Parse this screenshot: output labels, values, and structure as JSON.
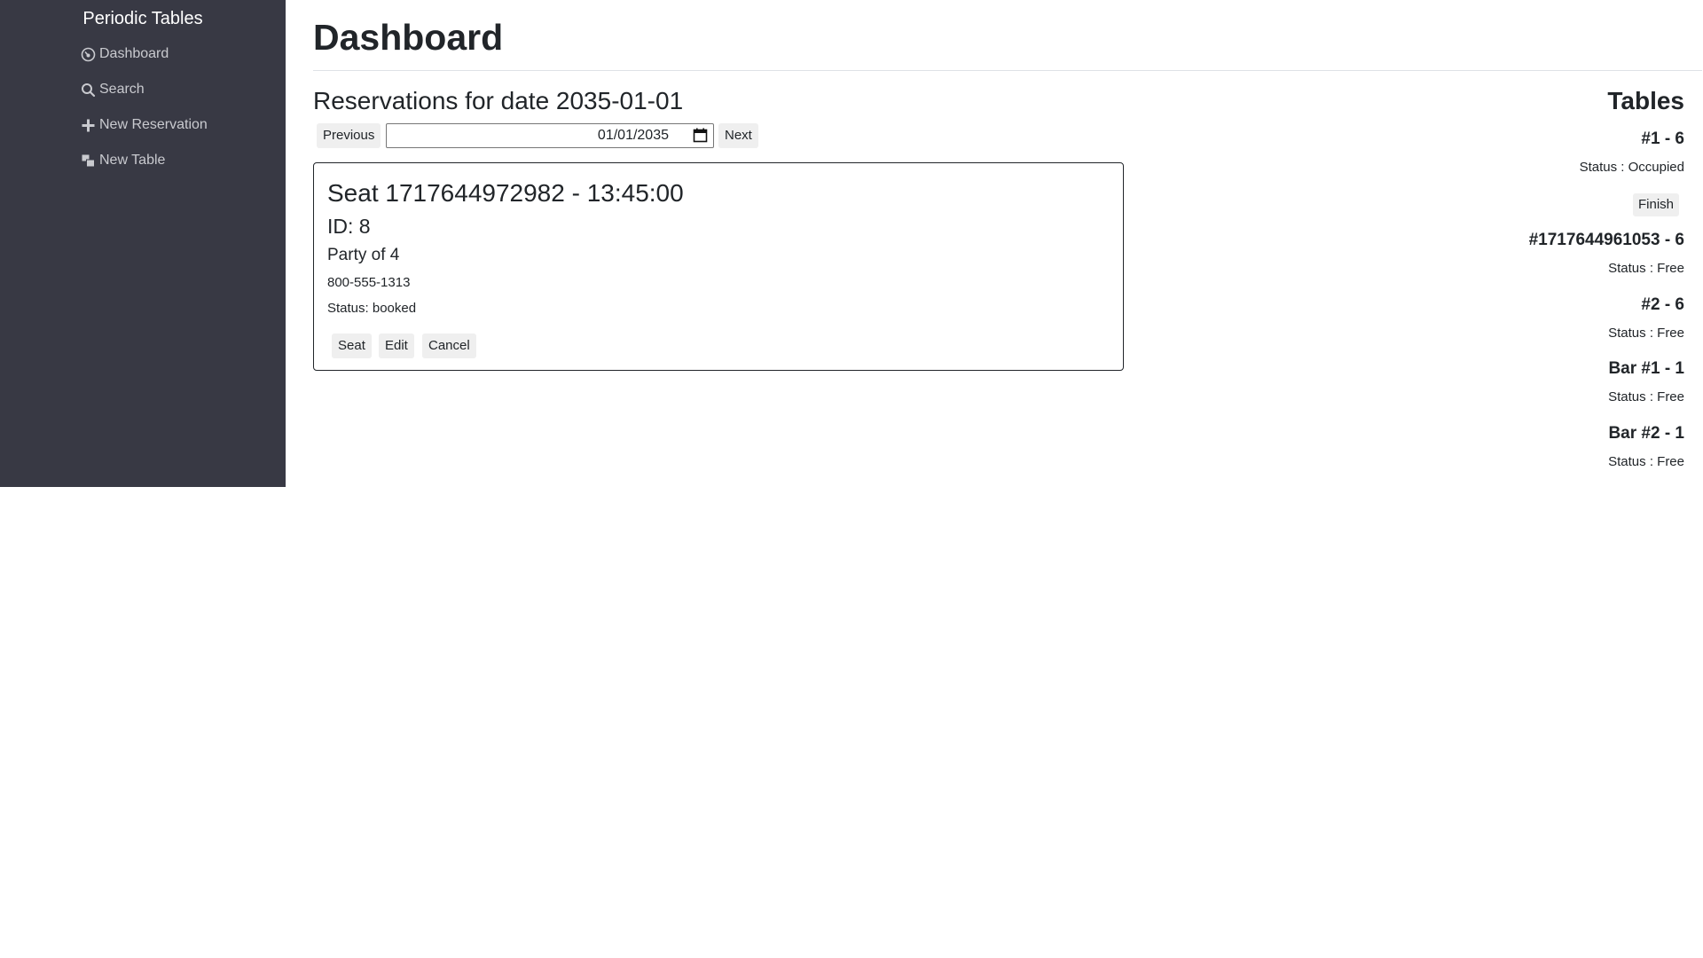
{
  "sidebar": {
    "brand": "Periodic Tables",
    "items": [
      {
        "label": "Dashboard",
        "icon": "dashboard-icon"
      },
      {
        "label": "Search",
        "icon": "search-icon"
      },
      {
        "label": "New Reservation",
        "icon": "plus-icon"
      },
      {
        "label": "New Table",
        "icon": "layers-icon"
      }
    ]
  },
  "main": {
    "title": "Dashboard",
    "reservations_heading": "Reservations for date 2035-01-01",
    "date_nav": {
      "previous_label": "Previous",
      "date_value": "01/01/2035",
      "next_label": "Next"
    },
    "reservations": [
      {
        "title": "Seat 1717644972982 - 13:45:00",
        "id_text": "ID: 8",
        "party_text": "Party of 4",
        "phone": "800-555-1313",
        "status_text": "Status: booked",
        "actions": {
          "seat": "Seat",
          "edit": "Edit",
          "cancel": "Cancel"
        }
      }
    ]
  },
  "tables": {
    "heading": "Tables",
    "items": [
      {
        "name": "#1 - 6",
        "status": "Status : Occupied",
        "finish_label": "Finish"
      },
      {
        "name": "#1717644961053 - 6",
        "status": "Status : Free"
      },
      {
        "name": "#2 - 6",
        "status": "Status : Free"
      },
      {
        "name": "Bar #1 - 1",
        "status": "Status : Free"
      },
      {
        "name": "Bar #2 - 1",
        "status": "Status : Free"
      }
    ]
  },
  "colors": {
    "sidebar_bg": "#383944",
    "sidebar_text": "#c9cacf",
    "button_bg": "#efefef",
    "text": "#212529"
  }
}
